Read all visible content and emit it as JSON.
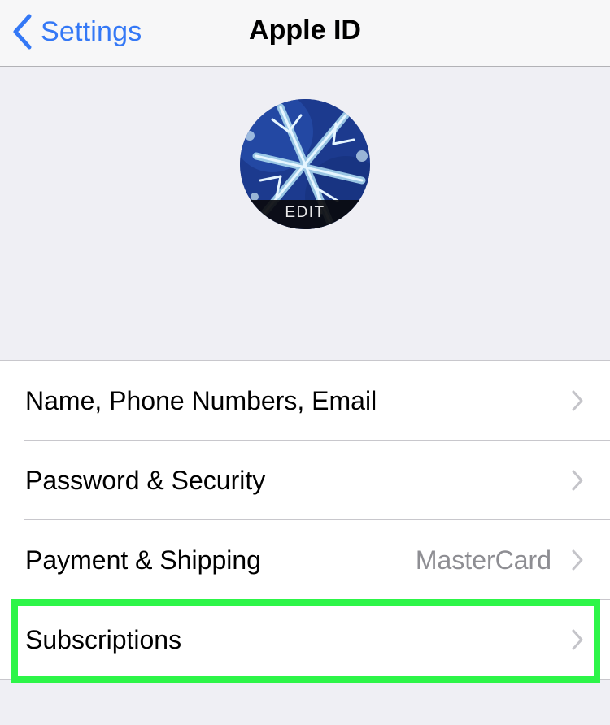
{
  "navbar": {
    "back_label": "Settings",
    "title": "Apple ID"
  },
  "profile": {
    "edit_label": "EDIT"
  },
  "list": {
    "items": [
      {
        "label": "Name, Phone Numbers, Email",
        "value": ""
      },
      {
        "label": "Password & Security",
        "value": ""
      },
      {
        "label": "Payment & Shipping",
        "value": "MasterCard"
      },
      {
        "label": "Subscriptions",
        "value": ""
      }
    ]
  },
  "icons": {
    "back": "chevron-left-icon",
    "row_disclosure": "chevron-right-icon"
  },
  "colors": {
    "accent": "#3478f6",
    "highlight": "#2df548",
    "background": "#efeff4",
    "secondary_text": "#8e8e93"
  }
}
